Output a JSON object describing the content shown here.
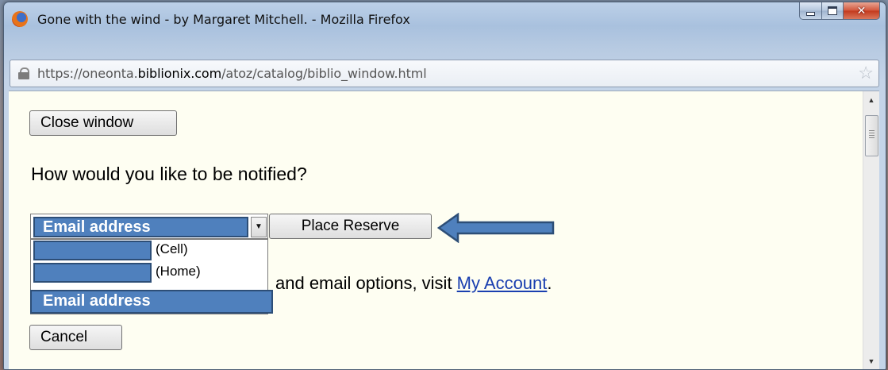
{
  "window": {
    "title": "Gone with the wind - by Margaret Mitchell. - Mozilla Firefox",
    "url_prefix": "https://oneonta.",
    "url_domain": "biblionix.com",
    "url_path": "/atoz/catalog/biblio_window.html"
  },
  "content": {
    "close_button": "Close window",
    "question": "How would you like to be notified?",
    "select_value": "Email address",
    "place_reserve": "Place Reserve",
    "options": [
      {
        "label": "(Cell)"
      },
      {
        "label": "(Home)"
      },
      {
        "label": "Email address"
      }
    ],
    "account_text": "and email options, visit ",
    "account_link": "My Account",
    "account_suffix": ".",
    "cancel_button": "Cancel"
  },
  "colors": {
    "highlight_fill": "#4f80bd",
    "highlight_border": "#2d4e77",
    "link": "#1a3fb0",
    "content_bg": "#fefef2"
  },
  "icons": [
    "firefox-icon",
    "minimize-icon",
    "maximize-icon",
    "close-icon",
    "lock-icon",
    "bookmark-star-icon",
    "dropdown-arrow-icon",
    "scroll-up-icon",
    "scroll-down-icon",
    "annotation-arrow-icon"
  ]
}
